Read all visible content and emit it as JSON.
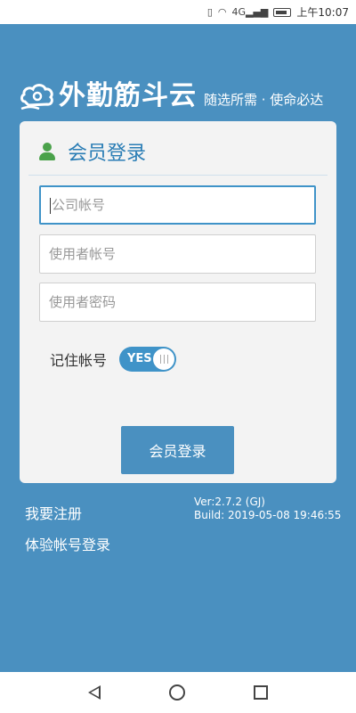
{
  "status_bar": {
    "signal_text": "4G",
    "time": "上午10:07"
  },
  "logo": {
    "title": "外勤筋斗云",
    "slogan": "随选所需 · 使命必达"
  },
  "login_card": {
    "title": "会员登录",
    "company_placeholder": "公司帐号",
    "user_placeholder": "使用者帐号",
    "password_placeholder": "使用者密码",
    "remember_label": "记住帐号",
    "toggle_state": "YES",
    "login_button": "会员登录"
  },
  "links": {
    "register": "我要注册",
    "trial_login": "体验帐号登录"
  },
  "version": {
    "ver": "Ver:2.7.2 (GJ)",
    "build": "Build: 2019-05-08 19:46:55"
  },
  "colors": {
    "background": "#4a90c0",
    "accent": "#3f93c8",
    "card": "#f3f3f3"
  }
}
